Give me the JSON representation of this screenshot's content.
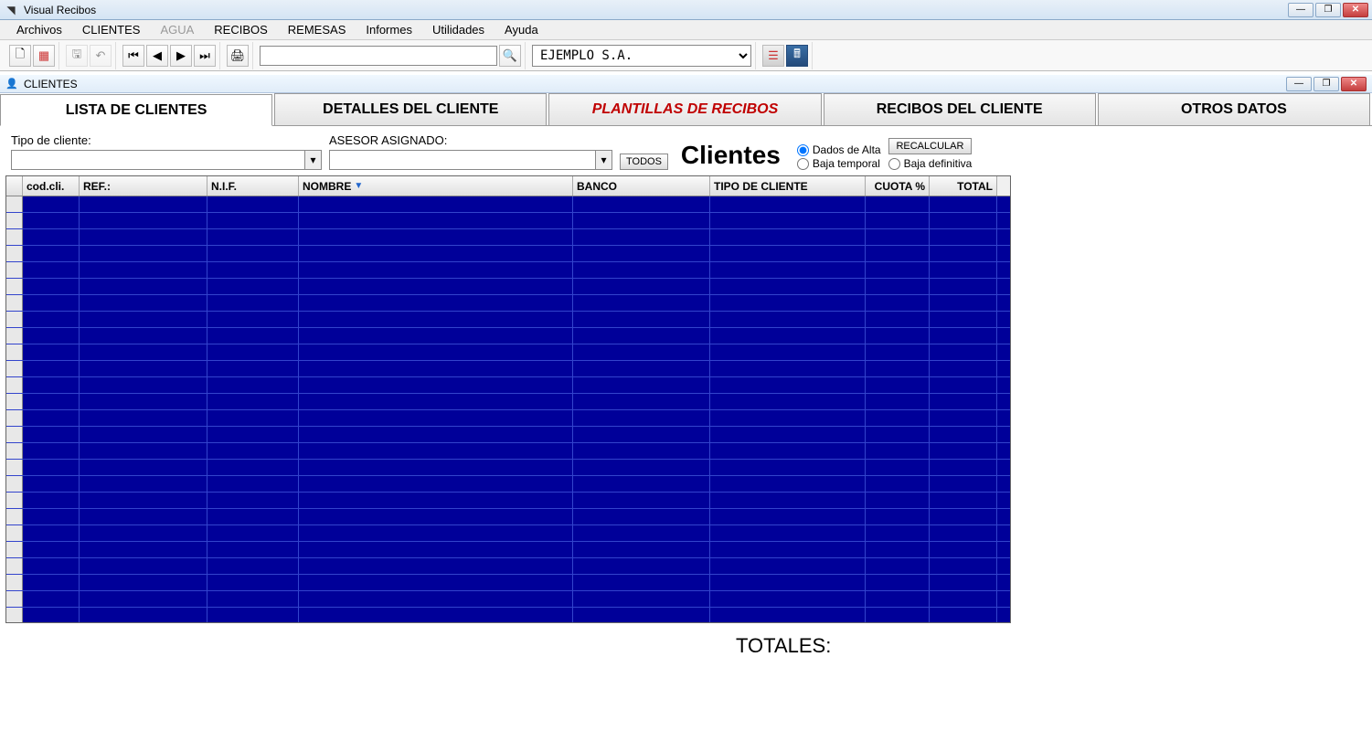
{
  "window": {
    "title": "Visual Recibos"
  },
  "menu": {
    "items": [
      "Archivos",
      "CLIENTES",
      "AGUA",
      "RECIBOS",
      "REMESAS",
      "Informes",
      "Utilidades",
      "Ayuda"
    ],
    "disabled_index": 2
  },
  "toolbar": {
    "company_value": "EJEMPLO S.A."
  },
  "child_window": {
    "title": "CLIENTES"
  },
  "tabs": {
    "items": [
      {
        "label": "LISTA DE CLIENTES",
        "style": "normal",
        "active": true
      },
      {
        "label": "DETALLES DEL CLIENTE",
        "style": "normal",
        "active": false
      },
      {
        "label": "PLANTILLAS DE RECIBOS",
        "style": "red-italic",
        "active": false
      },
      {
        "label": "RECIBOS DEL CLIENTE",
        "style": "normal",
        "active": false
      },
      {
        "label": "OTROS DATOS",
        "style": "normal",
        "active": false
      }
    ]
  },
  "filters": {
    "tipo_cliente_label": "Tipo de cliente:",
    "asesor_label": "ASESOR ASIGNADO:",
    "todos_label": "TODOS",
    "heading": "Clientes",
    "radio_alta": "Dados de Alta",
    "radio_baja_temp": "Baja temporal",
    "radio_baja_def": "Baja definitiva",
    "recalcular_label": "RECALCULAR"
  },
  "table": {
    "columns": [
      "cod.cli.",
      "REF.:",
      "N.I.F.",
      "NOMBRE",
      "BANCO",
      "TIPO DE CLIENTE",
      "CUOTA %",
      "TOTAL"
    ],
    "sort_column_index": 3,
    "rows": []
  },
  "footer": {
    "totals_label": "TOTALES:"
  }
}
